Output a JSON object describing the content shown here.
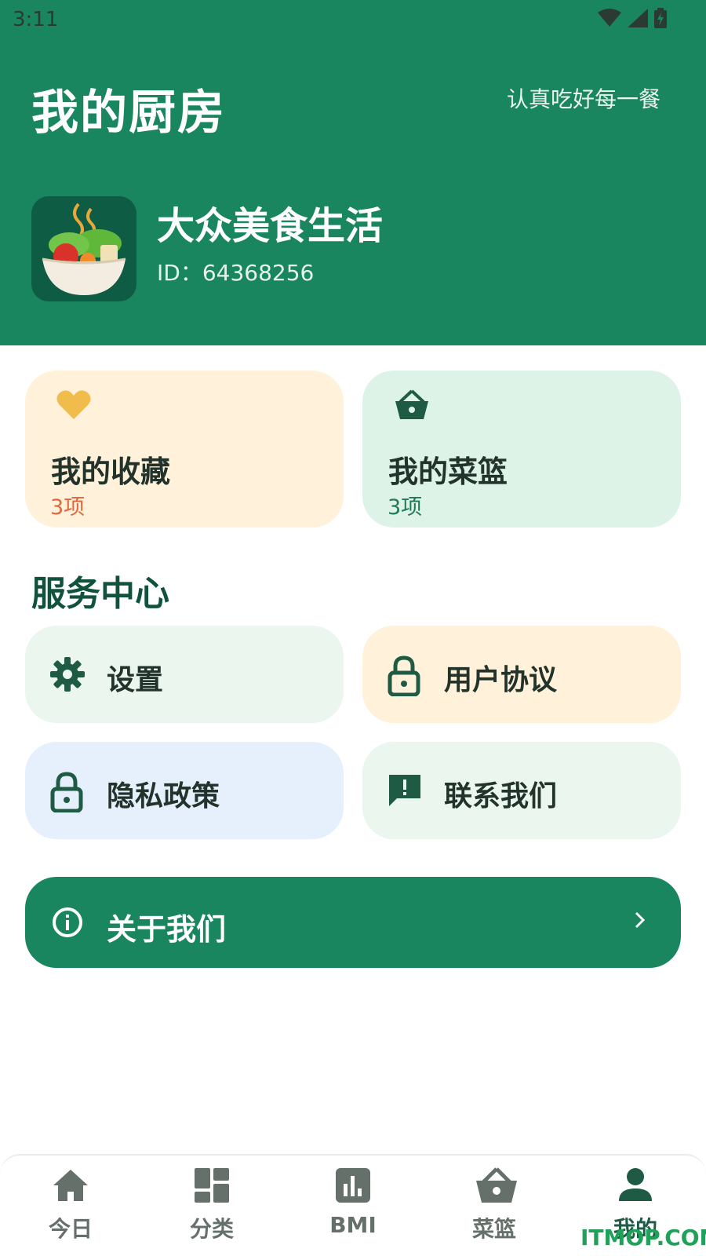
{
  "status_bar": {
    "time": "3:11"
  },
  "header": {
    "title": "我的厨房",
    "slogan": "认真吃好每一餐",
    "user": {
      "name": "大众美食生活",
      "id": "ID：64368256"
    }
  },
  "quick_cards": [
    {
      "title": "我的收藏",
      "count": "3项",
      "icon": "heart-icon",
      "color": "#fff1da"
    },
    {
      "title": "我的菜篮",
      "count": "3项",
      "icon": "basket-icon",
      "color": "#ddf3e8"
    }
  ],
  "services": {
    "title": "服务中心",
    "items": [
      {
        "label": "设置",
        "icon": "gear-icon"
      },
      {
        "label": "用户协议",
        "icon": "lock-icon"
      },
      {
        "label": "隐私政策",
        "icon": "lock-icon"
      },
      {
        "label": "联系我们",
        "icon": "feedback-icon"
      }
    ]
  },
  "about": {
    "label": "关于我们",
    "icon": "info-icon"
  },
  "bottom_nav": [
    {
      "label": "今日",
      "icon": "home-icon"
    },
    {
      "label": "分类",
      "icon": "dashboard-icon"
    },
    {
      "label": "BMI",
      "icon": "bar-chart-icon"
    },
    {
      "label": "菜篮",
      "icon": "basket-icon"
    },
    {
      "label": "我的",
      "icon": "person-icon",
      "active": true
    }
  ],
  "watermark": "ITMOP.COM",
  "colors": {
    "primary": "#1a8660",
    "accent_orange": "#e2673c",
    "heading": "#10523b"
  }
}
